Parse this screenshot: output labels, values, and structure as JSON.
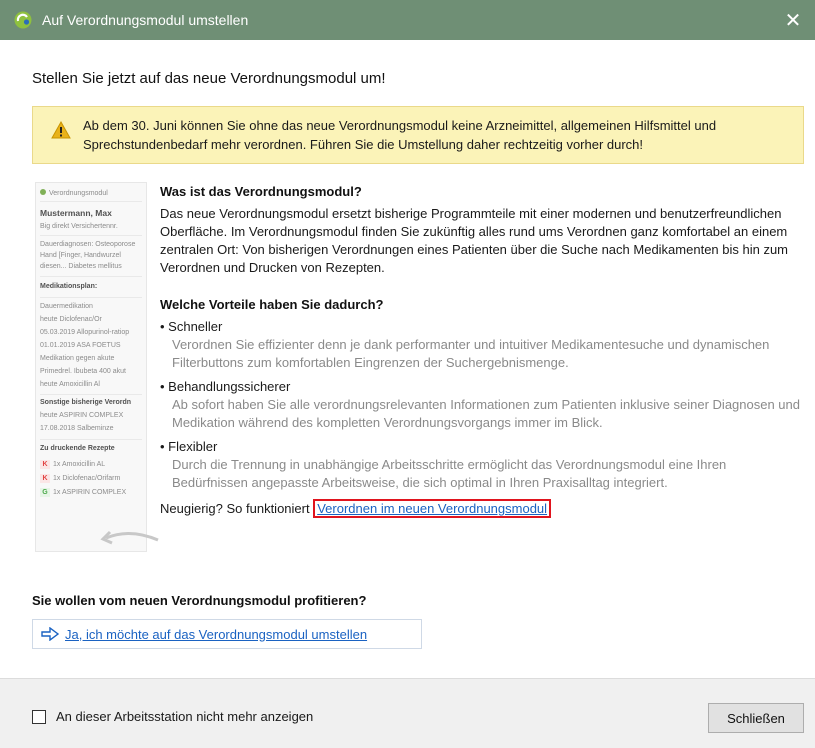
{
  "window": {
    "title": "Auf Verordnungsmodul umstellen",
    "close_glyph": "✕"
  },
  "heading": "Stellen Sie jetzt auf das neue Verordnungsmodul um!",
  "warning": {
    "text": "Ab dem 30. Juni können Sie ohne das neue Verordnungsmodul keine Arzneimittel, allgemeinen Hilfsmittel und Sprechstundenbedarf mehr verordnen. Führen Sie die Umstellung daher rechtzeitig vorher durch!"
  },
  "preview": {
    "rows": [
      "Verordnungsmodul",
      "Mustermann, Max",
      "Big direkt  Versichertennr.",
      "Dauerdiagnosen: Osteoporose",
      "Hand [Finger, Handwurzel",
      "diesen...  Diabetes mellitus",
      "Medikationsplan:",
      "Dauermedikation",
      "heute      Diclofenac/Or",
      "05.03.2019  Allopurinol-ratiop",
      "01.01.2019  ASA FOETUS",
      "Medikation gegen akute",
      "Primedrel.  Ibubeta 400 akut",
      "heute      Amoxicillin Al",
      "Sonstige bisherige Verordn",
      "heute      ASPIRIN COMPLEX",
      "17.08.2018  Salbeminze",
      "Zu druckende Rezepte",
      "1x  Amoxicillin AL",
      "1x  Diclofenac/Orifarm",
      "1x  ASPIRIN COMPLEX"
    ],
    "badges": [
      "K",
      "K",
      "G"
    ]
  },
  "what": {
    "title": "Was ist das Verordnungsmodul?",
    "text": "Das neue Verordnungsmodul ersetzt bisherige Programmteile mit einer modernen und benutzerfreundlichen Oberfläche. Im Verordnungsmodul finden Sie zukünftig alles rund ums Verordnen ganz komfortabel an einem zentralen Ort: Von bisherigen Verordnungen eines Patienten über die Suche nach Medikamenten bis hin zum Verordnen und Drucken von Rezepten."
  },
  "benefits": {
    "title": "Welche Vorteile haben Sie dadurch?",
    "items": [
      {
        "title": "• Schneller",
        "desc": "Verordnen Sie effizienter denn je dank performanter und intuitiver Medikamentesuche und dynamischen Filterbuttons zum komfortablen Eingrenzen der Suchergebnismenge."
      },
      {
        "title": "• Behandlungssicherer",
        "desc": "Ab sofort haben Sie alle verordnungsrelevanten Informationen zum Patienten inklusive seiner Diagnosen und Medikation während des kompletten Verordnungsvorgangs immer im Blick."
      },
      {
        "title": "• Flexibler",
        "desc": "Durch die Trennung in unabhängige Arbeitsschritte ermöglicht das Verordnungsmodul eine Ihren Bedürfnissen angepasste Arbeitsweise, die sich optimal in Ihren Praxisalltag integriert."
      }
    ]
  },
  "curious": {
    "prefix": "Neugierig? So funktioniert",
    "link": "Verordnen im neuen Verordnungsmodul"
  },
  "profit": {
    "title": "Sie wollen vom neuen Verordnungsmodul profitieren?",
    "action": "Ja, ich möchte auf das Verordnungsmodul umstellen"
  },
  "footer": {
    "checkbox_label": "An dieser Arbeitsstation nicht mehr anzeigen",
    "close_button": "Schließen"
  },
  "colors": {
    "titlebar": "#6f8f75",
    "warning_bg": "#fbf3b8",
    "link": "#1a62c2",
    "highlight": "#e0141e"
  }
}
